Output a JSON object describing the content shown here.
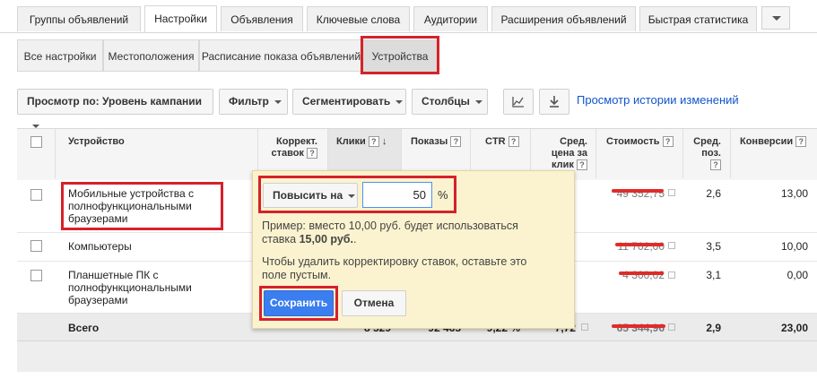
{
  "tabs": [
    {
      "label": "Группы объявлений"
    },
    {
      "label": "Настройки"
    },
    {
      "label": "Объявления"
    },
    {
      "label": "Ключевые слова"
    },
    {
      "label": "Аудитории"
    },
    {
      "label": "Расширения объявлений"
    },
    {
      "label": "Быстрая статистика"
    }
  ],
  "subtabs": [
    {
      "label": "Все настройки"
    },
    {
      "label": "Местоположения"
    },
    {
      "label": "Расписание показа объявлений"
    },
    {
      "label": "Устройства"
    }
  ],
  "toolbar": {
    "view_by": "Просмотр по: Уровень кампании",
    "filter": "Фильтр",
    "segment": "Сегментировать",
    "columns": "Столбцы",
    "history_link": "Просмотр истории изменений"
  },
  "table": {
    "headers": {
      "device": "Устройство",
      "bid_adj_1": "Коррект.",
      "bid_adj_2": "ставок",
      "clicks": "Клики",
      "impressions": "Показы",
      "ctr": "CTR",
      "avg_cpc_1": "Сред.",
      "avg_cpc_2": "цена за",
      "avg_cpc_3": "клик",
      "cost": "Стоимость",
      "avg_pos_1": "Сред.",
      "avg_pos_2": "поз.",
      "conversions": "Конверсии"
    },
    "rows": [
      {
        "device_1": "Мобильные устройства с",
        "device_2": "полнофункциональными",
        "device_3": "браузерами",
        "cost": "49 352,75",
        "avg_pos": "2,6",
        "conversions": "13,00"
      },
      {
        "device_1": "Компьютеры",
        "cost": "11 702,00",
        "avg_pos": "3,5",
        "conversions": "10,00"
      },
      {
        "device_1": "Планшетные ПК с",
        "device_2": "полнофункциональными",
        "device_3": "браузерами",
        "cost": "4 300,02",
        "avg_pos": "3,1",
        "conversions": "0,00"
      }
    ],
    "total": {
      "label": "Всего",
      "clicks": "8 529",
      "impressions": "92 465",
      "ctr": "9,22 %",
      "avg_cpc": "7,72",
      "cost": "65 344,96",
      "avg_pos": "2,9",
      "conversions": "23,00"
    }
  },
  "popup": {
    "mode_label": "Повысить на",
    "value": "50",
    "unit": "%",
    "example_line1": "Пример: вместо 10,00 руб. будет использоваться",
    "example_prefix": "ставка ",
    "example_bold": "15,00 руб.",
    "example_suffix": ".",
    "hint_line1": "Чтобы удалить корректировку ставок, оставьте это",
    "hint_line2": "поле пустым.",
    "save": "Сохранить",
    "cancel": "Отмена"
  },
  "colors": {
    "highlight": "#d6212b",
    "primary": "#3b7ef0",
    "link": "#1155cc",
    "popup_bg": "#fbf3cf"
  }
}
